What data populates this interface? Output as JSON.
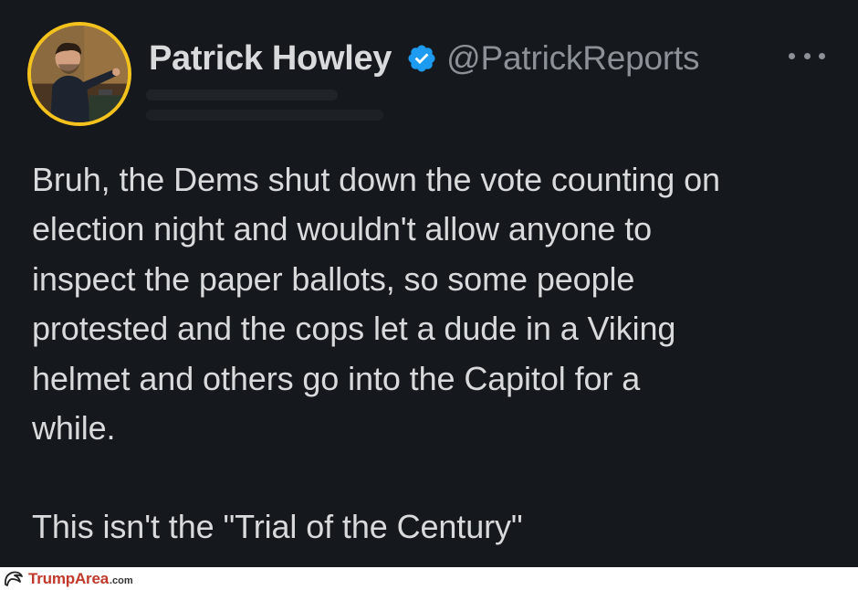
{
  "tweet": {
    "author": {
      "display_name": "Patrick Howley",
      "handle": "@PatrickReports",
      "verified": true,
      "avatar_ring_color": "#f3c21d"
    },
    "more_menu_icon": "more-horizontal-icon",
    "verified_icon": "verified-badge-icon",
    "verified_color": "#1d9bf0",
    "body": {
      "paragraph_1": "Bruh, the Dems shut down the vote counting on\nelection night and wouldn't allow anyone to\ninspect the paper ballots, so some people\nprotested and the cops let a dude in a Viking\nhelmet and others go into the Capitol for a\nwhile.",
      "paragraph_2": "This isn't the \"Trial of the Century\""
    },
    "background_color": "#15181c",
    "text_color": "#d9dadb",
    "secondary_text_color": "#8b9197"
  },
  "watermark": {
    "brand": "TrumpArea",
    "tld": ".com",
    "brand_color": "#c0392b",
    "logo_icon": "trump-hair-logo-icon"
  }
}
